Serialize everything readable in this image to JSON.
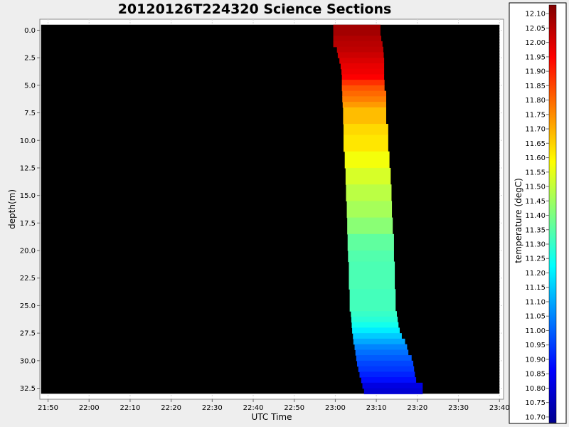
{
  "chart_data": {
    "type": "heatmap",
    "title": "20120126T224320 Science Sections",
    "xlabel": "UTC Time",
    "ylabel": "depth(m)",
    "colorbar_label": "temperature (degC)",
    "x_ticks": [
      "21:50",
      "22:00",
      "22:10",
      "22:20",
      "22:30",
      "22:40",
      "22:50",
      "23:00",
      "23:10",
      "23:20",
      "23:30",
      "23:40"
    ],
    "x_range_minutes": [
      1308,
      1421
    ],
    "y_ticks": [
      "0.0",
      "2.5",
      "5.0",
      "7.5",
      "10.0",
      "12.5",
      "15.0",
      "17.5",
      "20.0",
      "22.5",
      "25.0",
      "27.5",
      "30.0",
      "32.5"
    ],
    "y_range": [
      -1,
      33.5
    ],
    "y_inverted": true,
    "colorbar_ticks": [
      "12.10",
      "12.05",
      "12.00",
      "11.95",
      "11.90",
      "11.85",
      "11.80",
      "11.75",
      "11.70",
      "11.65",
      "11.60",
      "11.55",
      "11.50",
      "11.45",
      "11.40",
      "11.35",
      "11.30",
      "11.25",
      "11.20",
      "11.15",
      "11.10",
      "11.05",
      "11.00",
      "10.95",
      "10.90",
      "10.85",
      "10.80",
      "10.75",
      "10.70"
    ],
    "colorbar_range": [
      10.68,
      12.13
    ],
    "background_color": "#000000",
    "grid": true,
    "rows": [
      {
        "depth_top": 0.0,
        "depth_bottom": 0.5,
        "x_start_min": 1379.5,
        "x_end_min": 1391.0,
        "temperature": 12.08
      },
      {
        "depth_top": 0.5,
        "depth_bottom": 1.0,
        "x_start_min": 1379.5,
        "x_end_min": 1391.2,
        "temperature": 12.06
      },
      {
        "depth_top": 1.0,
        "depth_bottom": 1.5,
        "x_start_min": 1379.5,
        "x_end_min": 1391.5,
        "temperature": 12.05
      },
      {
        "depth_top": 1.5,
        "depth_bottom": 2.0,
        "x_start_min": 1380.4,
        "x_end_min": 1391.7,
        "temperature": 12.04
      },
      {
        "depth_top": 2.0,
        "depth_bottom": 2.5,
        "x_start_min": 1380.6,
        "x_end_min": 1391.8,
        "temperature": 12.02
      },
      {
        "depth_top": 2.5,
        "depth_bottom": 3.0,
        "x_start_min": 1381.0,
        "x_end_min": 1391.9,
        "temperature": 12.0
      },
      {
        "depth_top": 3.0,
        "depth_bottom": 3.5,
        "x_start_min": 1381.3,
        "x_end_min": 1391.9,
        "temperature": 11.98
      },
      {
        "depth_top": 3.5,
        "depth_bottom": 4.0,
        "x_start_min": 1381.5,
        "x_end_min": 1391.9,
        "temperature": 11.97
      },
      {
        "depth_top": 4.0,
        "depth_bottom": 4.5,
        "x_start_min": 1381.6,
        "x_end_min": 1391.9,
        "temperature": 11.95
      },
      {
        "depth_top": 4.5,
        "depth_bottom": 5.0,
        "x_start_min": 1381.6,
        "x_end_min": 1392.0,
        "temperature": 11.88
      },
      {
        "depth_top": 5.0,
        "depth_bottom": 5.5,
        "x_start_min": 1381.6,
        "x_end_min": 1392.0,
        "temperature": 11.83
      },
      {
        "depth_top": 5.5,
        "depth_bottom": 6.0,
        "x_start_min": 1381.7,
        "x_end_min": 1392.4,
        "temperature": 11.8
      },
      {
        "depth_top": 6.0,
        "depth_bottom": 6.5,
        "x_start_min": 1381.7,
        "x_end_min": 1392.4,
        "temperature": 11.77
      },
      {
        "depth_top": 6.5,
        "depth_bottom": 7.0,
        "x_start_min": 1381.8,
        "x_end_min": 1392.4,
        "temperature": 11.73
      },
      {
        "depth_top": 7.0,
        "depth_bottom": 8.5,
        "x_start_min": 1381.9,
        "x_end_min": 1392.4,
        "temperature": 11.68
      },
      {
        "depth_top": 8.5,
        "depth_bottom": 9.5,
        "x_start_min": 1382.0,
        "x_end_min": 1392.9,
        "temperature": 11.64
      },
      {
        "depth_top": 9.5,
        "depth_bottom": 11.0,
        "x_start_min": 1382.0,
        "x_end_min": 1392.9,
        "temperature": 11.62
      },
      {
        "depth_top": 11.0,
        "depth_bottom": 12.5,
        "x_start_min": 1382.3,
        "x_end_min": 1393.2,
        "temperature": 11.57
      },
      {
        "depth_top": 12.5,
        "depth_bottom": 14.0,
        "x_start_min": 1382.5,
        "x_end_min": 1393.5,
        "temperature": 11.53
      },
      {
        "depth_top": 14.0,
        "depth_bottom": 15.5,
        "x_start_min": 1382.6,
        "x_end_min": 1393.7,
        "temperature": 11.49
      },
      {
        "depth_top": 15.5,
        "depth_bottom": 17.0,
        "x_start_min": 1382.8,
        "x_end_min": 1393.8,
        "temperature": 11.46
      },
      {
        "depth_top": 17.0,
        "depth_bottom": 18.5,
        "x_start_min": 1382.9,
        "x_end_min": 1394.0,
        "temperature": 11.42
      },
      {
        "depth_top": 18.5,
        "depth_bottom": 20.0,
        "x_start_min": 1383.0,
        "x_end_min": 1394.3,
        "temperature": 11.36
      },
      {
        "depth_top": 20.0,
        "depth_bottom": 21.0,
        "x_start_min": 1383.1,
        "x_end_min": 1394.3,
        "temperature": 11.34
      },
      {
        "depth_top": 21.0,
        "depth_bottom": 23.5,
        "x_start_min": 1383.3,
        "x_end_min": 1394.5,
        "temperature": 11.33
      },
      {
        "depth_top": 23.5,
        "depth_bottom": 25.5,
        "x_start_min": 1383.5,
        "x_end_min": 1394.7,
        "temperature": 11.32
      },
      {
        "depth_top": 25.5,
        "depth_bottom": 26.0,
        "x_start_min": 1383.8,
        "x_end_min": 1395.0,
        "temperature": 11.3
      },
      {
        "depth_top": 26.0,
        "depth_bottom": 26.5,
        "x_start_min": 1383.9,
        "x_end_min": 1395.2,
        "temperature": 11.28
      },
      {
        "depth_top": 26.5,
        "depth_bottom": 27.0,
        "x_start_min": 1384.0,
        "x_end_min": 1395.4,
        "temperature": 11.25
      },
      {
        "depth_top": 27.0,
        "depth_bottom": 27.5,
        "x_start_min": 1384.1,
        "x_end_min": 1395.7,
        "temperature": 11.2
      },
      {
        "depth_top": 27.5,
        "depth_bottom": 28.0,
        "x_start_min": 1384.3,
        "x_end_min": 1396.2,
        "temperature": 11.15
      },
      {
        "depth_top": 28.0,
        "depth_bottom": 28.5,
        "x_start_min": 1384.4,
        "x_end_min": 1397.0,
        "temperature": 11.1
      },
      {
        "depth_top": 28.5,
        "depth_bottom": 29.0,
        "x_start_min": 1384.7,
        "x_end_min": 1397.5,
        "temperature": 11.05
      },
      {
        "depth_top": 29.0,
        "depth_bottom": 29.5,
        "x_start_min": 1384.9,
        "x_end_min": 1397.8,
        "temperature": 11.02
      },
      {
        "depth_top": 29.5,
        "depth_bottom": 30.0,
        "x_start_min": 1385.1,
        "x_end_min": 1398.6,
        "temperature": 10.99
      },
      {
        "depth_top": 30.0,
        "depth_bottom": 30.5,
        "x_start_min": 1385.3,
        "x_end_min": 1399.0,
        "temperature": 10.96
      },
      {
        "depth_top": 30.5,
        "depth_bottom": 31.0,
        "x_start_min": 1385.6,
        "x_end_min": 1399.2,
        "temperature": 10.94
      },
      {
        "depth_top": 31.0,
        "depth_bottom": 31.5,
        "x_start_min": 1385.9,
        "x_end_min": 1399.4,
        "temperature": 10.91
      },
      {
        "depth_top": 31.5,
        "depth_bottom": 32.0,
        "x_start_min": 1386.3,
        "x_end_min": 1399.7,
        "temperature": 10.88
      },
      {
        "depth_top": 32.0,
        "depth_bottom": 32.5,
        "x_start_min": 1386.6,
        "x_end_min": 1401.3,
        "temperature": 10.82
      },
      {
        "depth_top": 32.5,
        "depth_bottom": 33.0,
        "x_start_min": 1387.0,
        "x_end_min": 1401.3,
        "temperature": 10.8
      }
    ]
  }
}
